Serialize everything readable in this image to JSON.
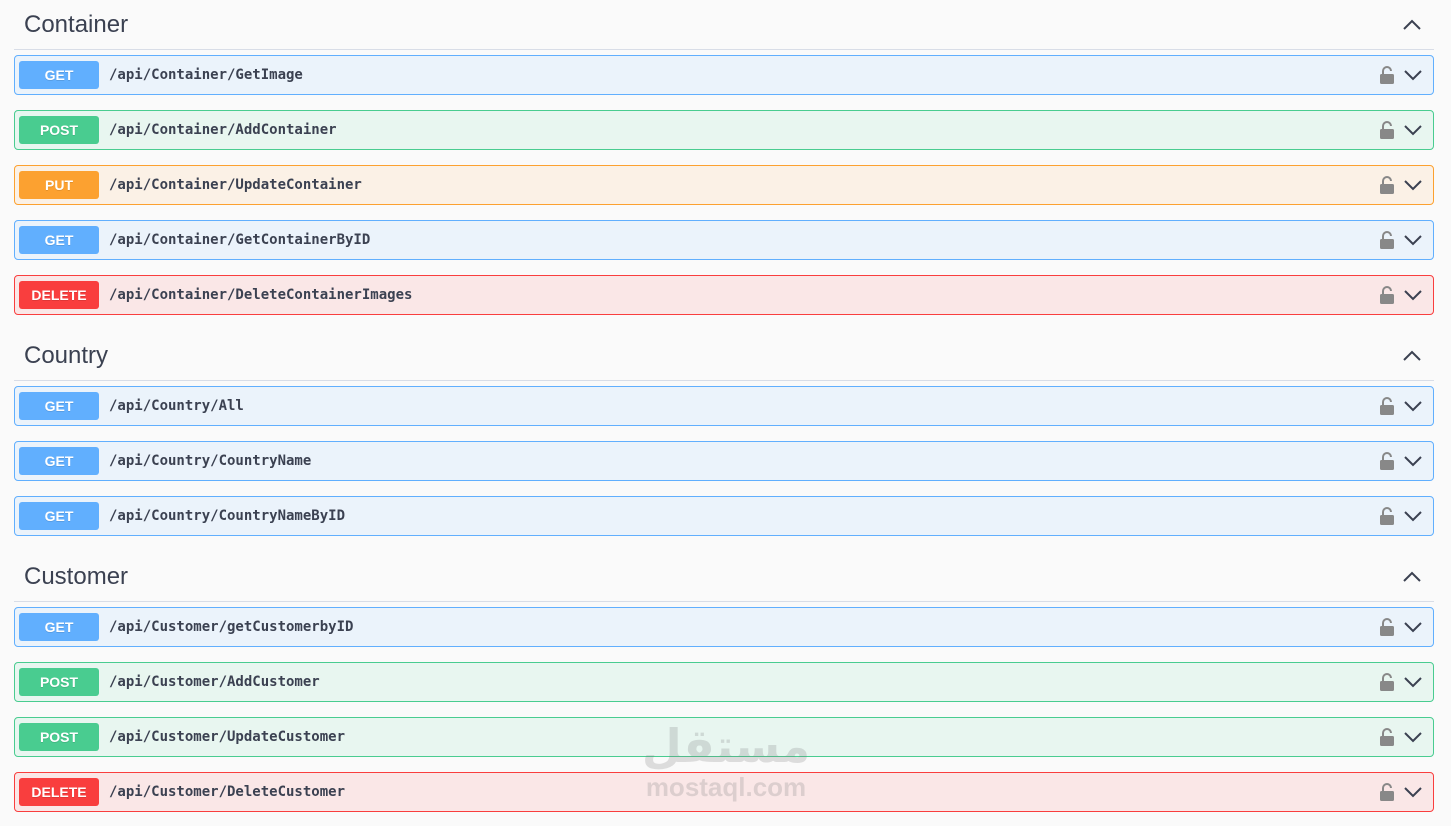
{
  "sections": [
    {
      "title": "Container",
      "operations": [
        {
          "method": "GET",
          "path": "/api/Container/GetImage"
        },
        {
          "method": "POST",
          "path": "/api/Container/AddContainer"
        },
        {
          "method": "PUT",
          "path": "/api/Container/UpdateContainer"
        },
        {
          "method": "GET",
          "path": "/api/Container/GetContainerByID"
        },
        {
          "method": "DELETE",
          "path": "/api/Container/DeleteContainerImages"
        }
      ]
    },
    {
      "title": "Country",
      "operations": [
        {
          "method": "GET",
          "path": "/api/Country/All"
        },
        {
          "method": "GET",
          "path": "/api/Country/CountryName"
        },
        {
          "method": "GET",
          "path": "/api/Country/CountryNameByID"
        }
      ]
    },
    {
      "title": "Customer",
      "operations": [
        {
          "method": "GET",
          "path": "/api/Customer/getCustomerbyID"
        },
        {
          "method": "POST",
          "path": "/api/Customer/AddCustomer"
        },
        {
          "method": "POST",
          "path": "/api/Customer/UpdateCustomer"
        },
        {
          "method": "DELETE",
          "path": "/api/Customer/DeleteCustomer"
        }
      ]
    }
  ],
  "watermark": {
    "arabic": "مستقل",
    "latin": "mostaql.com"
  },
  "colors": {
    "get": "#61affe",
    "post": "#49cc90",
    "put": "#fca130",
    "delete": "#f93e3e"
  },
  "icons": {
    "section_toggle": "chevron-up-icon",
    "lock": "lock-icon",
    "expand": "chevron-down-icon"
  }
}
